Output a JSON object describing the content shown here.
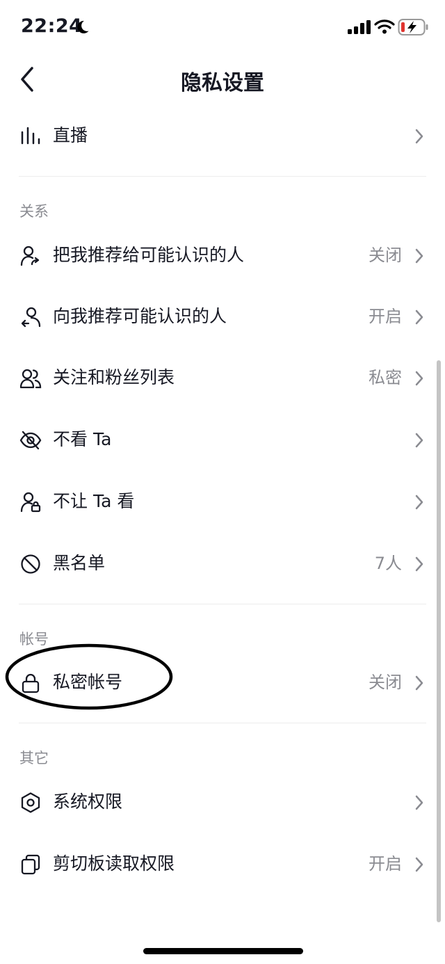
{
  "status_bar": {
    "time": "22:24"
  },
  "header": {
    "title": "隐私设置"
  },
  "top_items": [
    {
      "label": "直播",
      "value": "",
      "icon": "bar-chart-icon"
    }
  ],
  "sections": [
    {
      "title": "关系",
      "items": [
        {
          "label": "把我推荐给可能认识的人",
          "value": "关闭",
          "icon": "user-share-icon"
        },
        {
          "label": "向我推荐可能认识的人",
          "value": "开启",
          "icon": "user-recommend-icon"
        },
        {
          "label": "关注和粉丝列表",
          "value": "私密",
          "icon": "users-icon"
        },
        {
          "label": "不看 Ta",
          "value": "",
          "icon": "eye-off-icon"
        },
        {
          "label": "不让 Ta 看",
          "value": "",
          "icon": "user-lock-icon"
        },
        {
          "label": "黑名单",
          "value": "7人",
          "icon": "block-icon"
        }
      ]
    },
    {
      "title": "帐号",
      "items": [
        {
          "label": "私密帐号",
          "value": "关闭",
          "icon": "lock-icon"
        }
      ]
    },
    {
      "title": "其它",
      "items": [
        {
          "label": "系统权限",
          "value": "",
          "icon": "hexagon-settings-icon"
        },
        {
          "label": "剪切板读取权限",
          "value": "开启",
          "icon": "clipboard-icon"
        }
      ]
    }
  ]
}
